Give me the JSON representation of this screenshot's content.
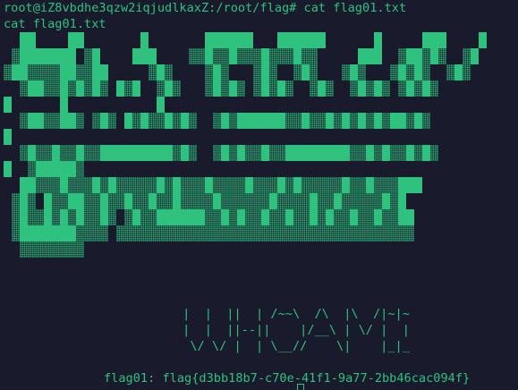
{
  "terminal": {
    "prompt_line": "root@iZ8vbdhe3qzw2iqjudlkaxZ:/root/flag# cat flag01.txt",
    "echo_line": "cat flag01.txt",
    "ascii_art": [
      " |  |  ||  | /~~\\  /\\  |\\  /|~|~",
      " |  |  ||--||    |/__\\ | \\/ |  |",
      "  \\/ \\/ |  | \\__//    \\|    |_|_"
    ],
    "flag_line": "flag01: flag{d3bb18b7-c70e-41f1-9a77-2bb46cac094f}"
  },
  "colors": {
    "background": "#191b2d",
    "text": "#2ec27e"
  }
}
